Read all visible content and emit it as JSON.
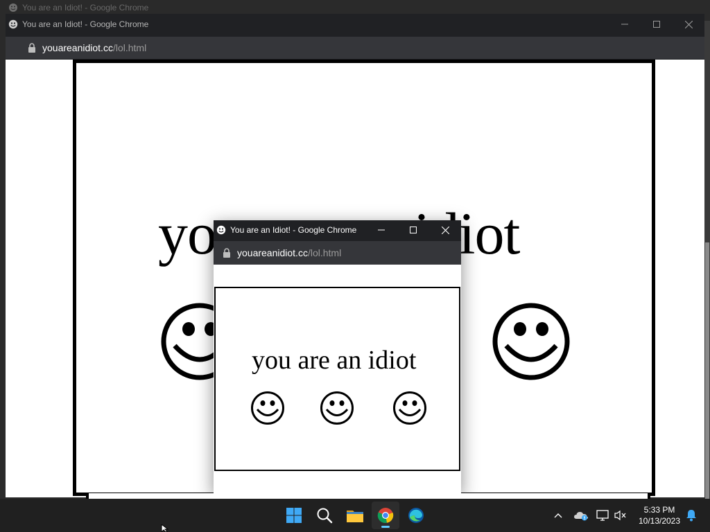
{
  "windows": {
    "ghost": {
      "title": "You are an Idiot! - Google Chrome"
    },
    "main": {
      "title": "You are an Idiot! - Google Chrome",
      "url_host": "youareanidiot.cc",
      "url_path": "/lol.html",
      "page_text": "you are an idiot"
    },
    "popup": {
      "title": "You are an Idiot! - Google Chrome",
      "url_host": "youareanidiot.cc",
      "url_path": "/lol.html",
      "page_text": "you are an idiot"
    }
  },
  "taskbar": {
    "apps": [
      {
        "icon": "windows-start-icon"
      },
      {
        "icon": "search-icon"
      },
      {
        "icon": "file-explorer-icon"
      },
      {
        "icon": "chrome-icon",
        "active": true
      },
      {
        "icon": "edge-icon"
      }
    ],
    "tray": [
      "chevron-up-icon",
      "onedrive-icon",
      "network-icon",
      "volume-muted-icon",
      "notification-bell-icon"
    ],
    "time": "5:33 PM",
    "date": "10/13/2023"
  },
  "colors": {
    "chrome_title_bg": "#202124",
    "chrome_toolbar_bg": "#35363a",
    "taskbar_bg": "#202020",
    "accent": "#60cdff"
  }
}
